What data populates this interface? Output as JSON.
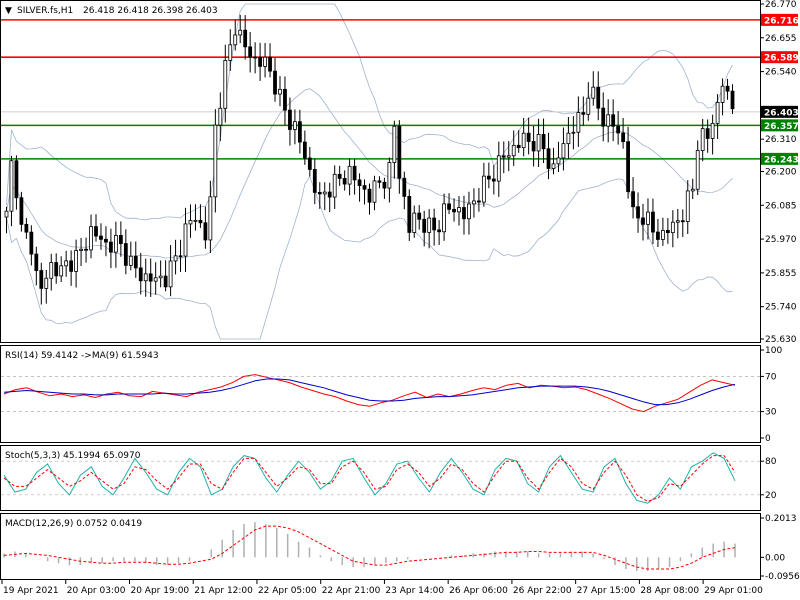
{
  "header": {
    "symbol": "SILVER.fs,H1",
    "ohlc": "26.418 26.418 26.398 26.403"
  },
  "colors": {
    "bull": "#000000",
    "bear": "#000000",
    "bands": "#9fb3cc",
    "resistance": "#ff0000",
    "support": "#008000",
    "rsi": "#ff0000",
    "rsi_ma": "#0000cc",
    "stoch_main": "#20b2aa",
    "stoch_signal": "#ff0000",
    "macd_hist": "#b0b0b0",
    "macd_signal": "#ff0000"
  },
  "chart_data": [
    {
      "type": "candlestick",
      "panel": "price",
      "ylim": [
        25.63,
        26.77
      ],
      "y_ticks": [
        "26.770",
        "26.655",
        "26.540",
        "26.425",
        "26.310",
        "26.200",
        "26.085",
        "25.970",
        "25.855",
        "25.740",
        "25.630"
      ],
      "current_price": "26.403",
      "levels": [
        {
          "value": 26.716,
          "label": "26.716",
          "kind": "resistance"
        },
        {
          "value": 26.589,
          "label": "26.589",
          "kind": "resistance"
        },
        {
          "value": 26.357,
          "label": "26.357",
          "kind": "support"
        },
        {
          "value": 26.243,
          "label": "26.243",
          "kind": "support"
        }
      ],
      "close_path": [
        [
          0,
          26.05
        ],
        [
          1,
          26.22
        ],
        [
          2,
          26.15
        ],
        [
          3,
          26.0
        ],
        [
          5,
          25.95
        ],
        [
          6,
          25.85
        ],
        [
          7,
          25.8
        ],
        [
          9,
          25.88
        ],
        [
          11,
          25.86
        ],
        [
          13,
          25.9
        ],
        [
          15,
          25.92
        ],
        [
          17,
          26.0
        ],
        [
          20,
          25.95
        ],
        [
          22,
          25.96
        ],
        [
          24,
          25.92
        ],
        [
          26,
          25.86
        ],
        [
          28,
          25.84
        ],
        [
          30,
          25.83
        ],
        [
          32,
          25.84
        ],
        [
          34,
          25.9
        ],
        [
          36,
          26.0
        ],
        [
          38,
          26.05
        ],
        [
          40,
          25.98
        ],
        [
          41,
          26.1
        ],
        [
          42,
          26.35
        ],
        [
          43,
          26.45
        ],
        [
          44,
          26.55
        ],
        [
          45,
          26.62
        ],
        [
          46,
          26.7
        ],
        [
          48,
          26.62
        ],
        [
          50,
          26.58
        ],
        [
          52,
          26.57
        ],
        [
          54,
          26.5
        ],
        [
          55,
          26.45
        ],
        [
          56,
          26.4
        ],
        [
          58,
          26.35
        ],
        [
          59,
          26.3
        ],
        [
          61,
          26.2
        ],
        [
          63,
          26.1
        ],
        [
          65,
          26.15
        ],
        [
          67,
          26.17
        ],
        [
          69,
          26.2
        ],
        [
          71,
          26.15
        ],
        [
          73,
          26.12
        ],
        [
          75,
          26.16
        ],
        [
          77,
          26.2
        ],
        [
          78,
          26.35
        ],
        [
          79,
          26.2
        ],
        [
          81,
          26.0
        ],
        [
          82,
          26.05
        ],
        [
          84,
          26.02
        ],
        [
          86,
          26.0
        ],
        [
          88,
          26.06
        ],
        [
          90,
          26.08
        ],
        [
          92,
          26.05
        ],
        [
          94,
          26.1
        ],
        [
          96,
          26.15
        ],
        [
          98,
          26.2
        ],
        [
          100,
          26.25
        ],
        [
          102,
          26.28
        ],
        [
          104,
          26.31
        ],
        [
          106,
          26.3
        ],
        [
          108,
          26.28
        ],
        [
          110,
          26.2
        ],
        [
          112,
          26.3
        ],
        [
          114,
          26.35
        ],
        [
          116,
          26.4
        ],
        [
          117,
          26.48
        ],
        [
          118,
          26.45
        ],
        [
          119,
          26.42
        ],
        [
          120,
          26.38
        ],
        [
          122,
          26.36
        ],
        [
          124,
          26.3
        ],
        [
          125,
          26.15
        ],
        [
          126,
          26.05
        ],
        [
          128,
          26.05
        ],
        [
          130,
          26.0
        ],
        [
          132,
          25.98
        ],
        [
          134,
          26.02
        ],
        [
          136,
          26.05
        ],
        [
          138,
          26.15
        ],
        [
          139,
          26.3
        ],
        [
          141,
          26.32
        ],
        [
          142,
          26.38
        ],
        [
          143,
          26.42
        ],
        [
          144,
          26.5
        ],
        [
          145,
          26.46
        ],
        [
          146,
          26.42
        ]
      ]
    },
    {
      "type": "line",
      "panel": "rsi",
      "label": "RSI(14) 59.4142  ->MA(9) 61.5943",
      "ylim": [
        0,
        100
      ],
      "y_ticks": [
        "100",
        "70",
        "30",
        "0"
      ],
      "levels": [
        70,
        30
      ],
      "series": [
        {
          "name": "RSI(14)",
          "values": [
            50,
            55,
            57,
            52,
            48,
            50,
            47,
            49,
            46,
            50,
            52,
            48,
            47,
            53,
            51,
            49,
            47,
            52,
            55,
            58,
            63,
            70,
            72,
            69,
            66,
            63,
            58,
            54,
            50,
            47,
            42,
            38,
            36,
            40,
            43,
            48,
            52,
            46,
            50,
            47,
            50,
            54,
            57,
            55,
            60,
            62,
            57,
            60,
            59,
            57,
            58,
            55,
            50,
            45,
            39,
            33,
            30,
            36,
            40,
            44,
            52,
            60,
            66,
            63,
            60
          ]
        },
        {
          "name": "MA(9)",
          "values": [
            52,
            53,
            54,
            53,
            52,
            51,
            50,
            50,
            49,
            49,
            50,
            50,
            50,
            50,
            51,
            50,
            50,
            51,
            52,
            54,
            57,
            61,
            65,
            67,
            67,
            66,
            63,
            60,
            57,
            53,
            49,
            46,
            43,
            42,
            42,
            43,
            45,
            46,
            47,
            47,
            48,
            49,
            51,
            53,
            55,
            57,
            58,
            59,
            59,
            59,
            59,
            58,
            56,
            53,
            49,
            45,
            41,
            38,
            38,
            40,
            44,
            49,
            54,
            58,
            61
          ]
        }
      ]
    },
    {
      "type": "line",
      "panel": "stochastic",
      "label": "Stoch(5,3,3) 45.1994 65.0970",
      "ylim": [
        0,
        100
      ],
      "y_ticks": [
        "80",
        "20"
      ],
      "levels": [
        80,
        20
      ],
      "series": [
        {
          "name": "Main",
          "values": [
            55,
            25,
            30,
            60,
            75,
            40,
            20,
            55,
            70,
            35,
            20,
            50,
            85,
            60,
            30,
            20,
            60,
            85,
            70,
            20,
            30,
            70,
            90,
            85,
            50,
            25,
            55,
            80,
            60,
            30,
            45,
            80,
            85,
            50,
            20,
            40,
            75,
            80,
            50,
            25,
            60,
            85,
            60,
            30,
            20,
            65,
            85,
            80,
            40,
            25,
            70,
            90,
            60,
            30,
            25,
            70,
            85,
            40,
            10,
            5,
            20,
            50,
            30,
            70,
            80,
            95,
            85,
            45
          ]
        },
        {
          "name": "Signal",
          "values": [
            50,
            35,
            35,
            50,
            65,
            50,
            35,
            45,
            60,
            45,
            30,
            40,
            70,
            65,
            45,
            30,
            50,
            75,
            75,
            40,
            30,
            60,
            85,
            85,
            60,
            35,
            50,
            70,
            65,
            40,
            40,
            70,
            80,
            60,
            30,
            35,
            65,
            75,
            60,
            35,
            50,
            75,
            65,
            40,
            25,
            55,
            80,
            80,
            50,
            30,
            60,
            85,
            70,
            40,
            30,
            60,
            80,
            55,
            20,
            8,
            15,
            40,
            35,
            55,
            75,
            90,
            90,
            60
          ]
        }
      ]
    },
    {
      "type": "bar",
      "panel": "macd",
      "label": "MACD(12,26,9) 0.0752 0.0419",
      "ylim": [
        -0.0956,
        0.2013
      ],
      "y_ticks": [
        "0.2013",
        "0.00",
        "-0.0956"
      ],
      "series": [
        {
          "name": "MACD",
          "values": [
            0.02,
            0.03,
            0.02,
            0.0,
            -0.02,
            -0.03,
            -0.04,
            -0.04,
            -0.03,
            -0.03,
            -0.02,
            -0.02,
            -0.02,
            -0.03,
            -0.04,
            -0.04,
            -0.03,
            -0.02,
            0.0,
            0.04,
            0.09,
            0.14,
            0.17,
            0.18,
            0.17,
            0.15,
            0.12,
            0.08,
            0.05,
            0.01,
            -0.02,
            -0.04,
            -0.05,
            -0.05,
            -0.04,
            -0.03,
            -0.02,
            -0.01,
            0.0,
            0.0,
            0.0,
            0.01,
            0.01,
            0.02,
            0.02,
            0.03,
            0.03,
            0.03,
            0.03,
            0.02,
            0.02,
            0.02,
            0.03,
            0.03,
            0.02,
            -0.01,
            -0.04,
            -0.06,
            -0.07,
            -0.07,
            -0.06,
            -0.05,
            -0.02,
            0.02,
            0.05,
            0.07,
            0.08,
            0.07
          ]
        },
        {
          "name": "Signal",
          "values": [
            0.01,
            0.015,
            0.02,
            0.015,
            0.01,
            0.0,
            -0.01,
            -0.02,
            -0.025,
            -0.03,
            -0.03,
            -0.025,
            -0.025,
            -0.025,
            -0.03,
            -0.035,
            -0.035,
            -0.03,
            -0.02,
            -0.01,
            0.02,
            0.06,
            0.1,
            0.14,
            0.16,
            0.16,
            0.15,
            0.13,
            0.1,
            0.07,
            0.04,
            0.01,
            -0.02,
            -0.03,
            -0.04,
            -0.04,
            -0.03,
            -0.02,
            -0.015,
            -0.01,
            -0.005,
            0.0,
            0.005,
            0.01,
            0.015,
            0.02,
            0.025,
            0.025,
            0.03,
            0.03,
            0.025,
            0.025,
            0.025,
            0.025,
            0.025,
            0.01,
            -0.01,
            -0.03,
            -0.05,
            -0.06,
            -0.06,
            -0.06,
            -0.05,
            -0.03,
            0.0,
            0.02,
            0.04,
            0.05
          ]
        }
      ]
    }
  ],
  "x_axis": {
    "labels": [
      "19 Apr 2021",
      "20 Apr 03:00",
      "20 Apr 19:00",
      "21 Apr 12:00",
      "22 Apr 05:00",
      "22 Apr 21:00",
      "23 Apr 14:00",
      "26 Apr 06:00",
      "26 Apr 22:00",
      "27 Apr 15:00",
      "28 Apr 08:00",
      "29 Apr 01:00"
    ]
  }
}
